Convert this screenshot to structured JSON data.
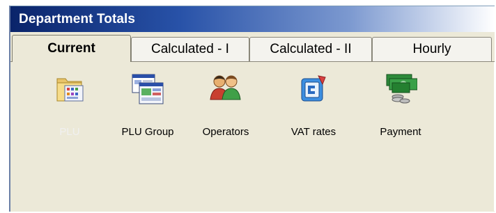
{
  "window": {
    "title": "Department Totals"
  },
  "tabs": [
    {
      "label": "Current",
      "active": true
    },
    {
      "label": "Calculated - I",
      "active": false
    },
    {
      "label": "Calculated - II",
      "active": false
    },
    {
      "label": "Hourly",
      "active": false
    }
  ],
  "items": [
    {
      "label": "PLU",
      "icon": "plu-folder-icon",
      "selected": true
    },
    {
      "label": "PLU Group",
      "icon": "plu-group-windows-icon",
      "selected": false
    },
    {
      "label": "Operators",
      "icon": "operators-people-icon",
      "selected": false
    },
    {
      "label": "VAT rates",
      "icon": "vat-rates-icon",
      "selected": false
    },
    {
      "label": "Payment",
      "icon": "payment-money-icon",
      "selected": false
    }
  ]
}
